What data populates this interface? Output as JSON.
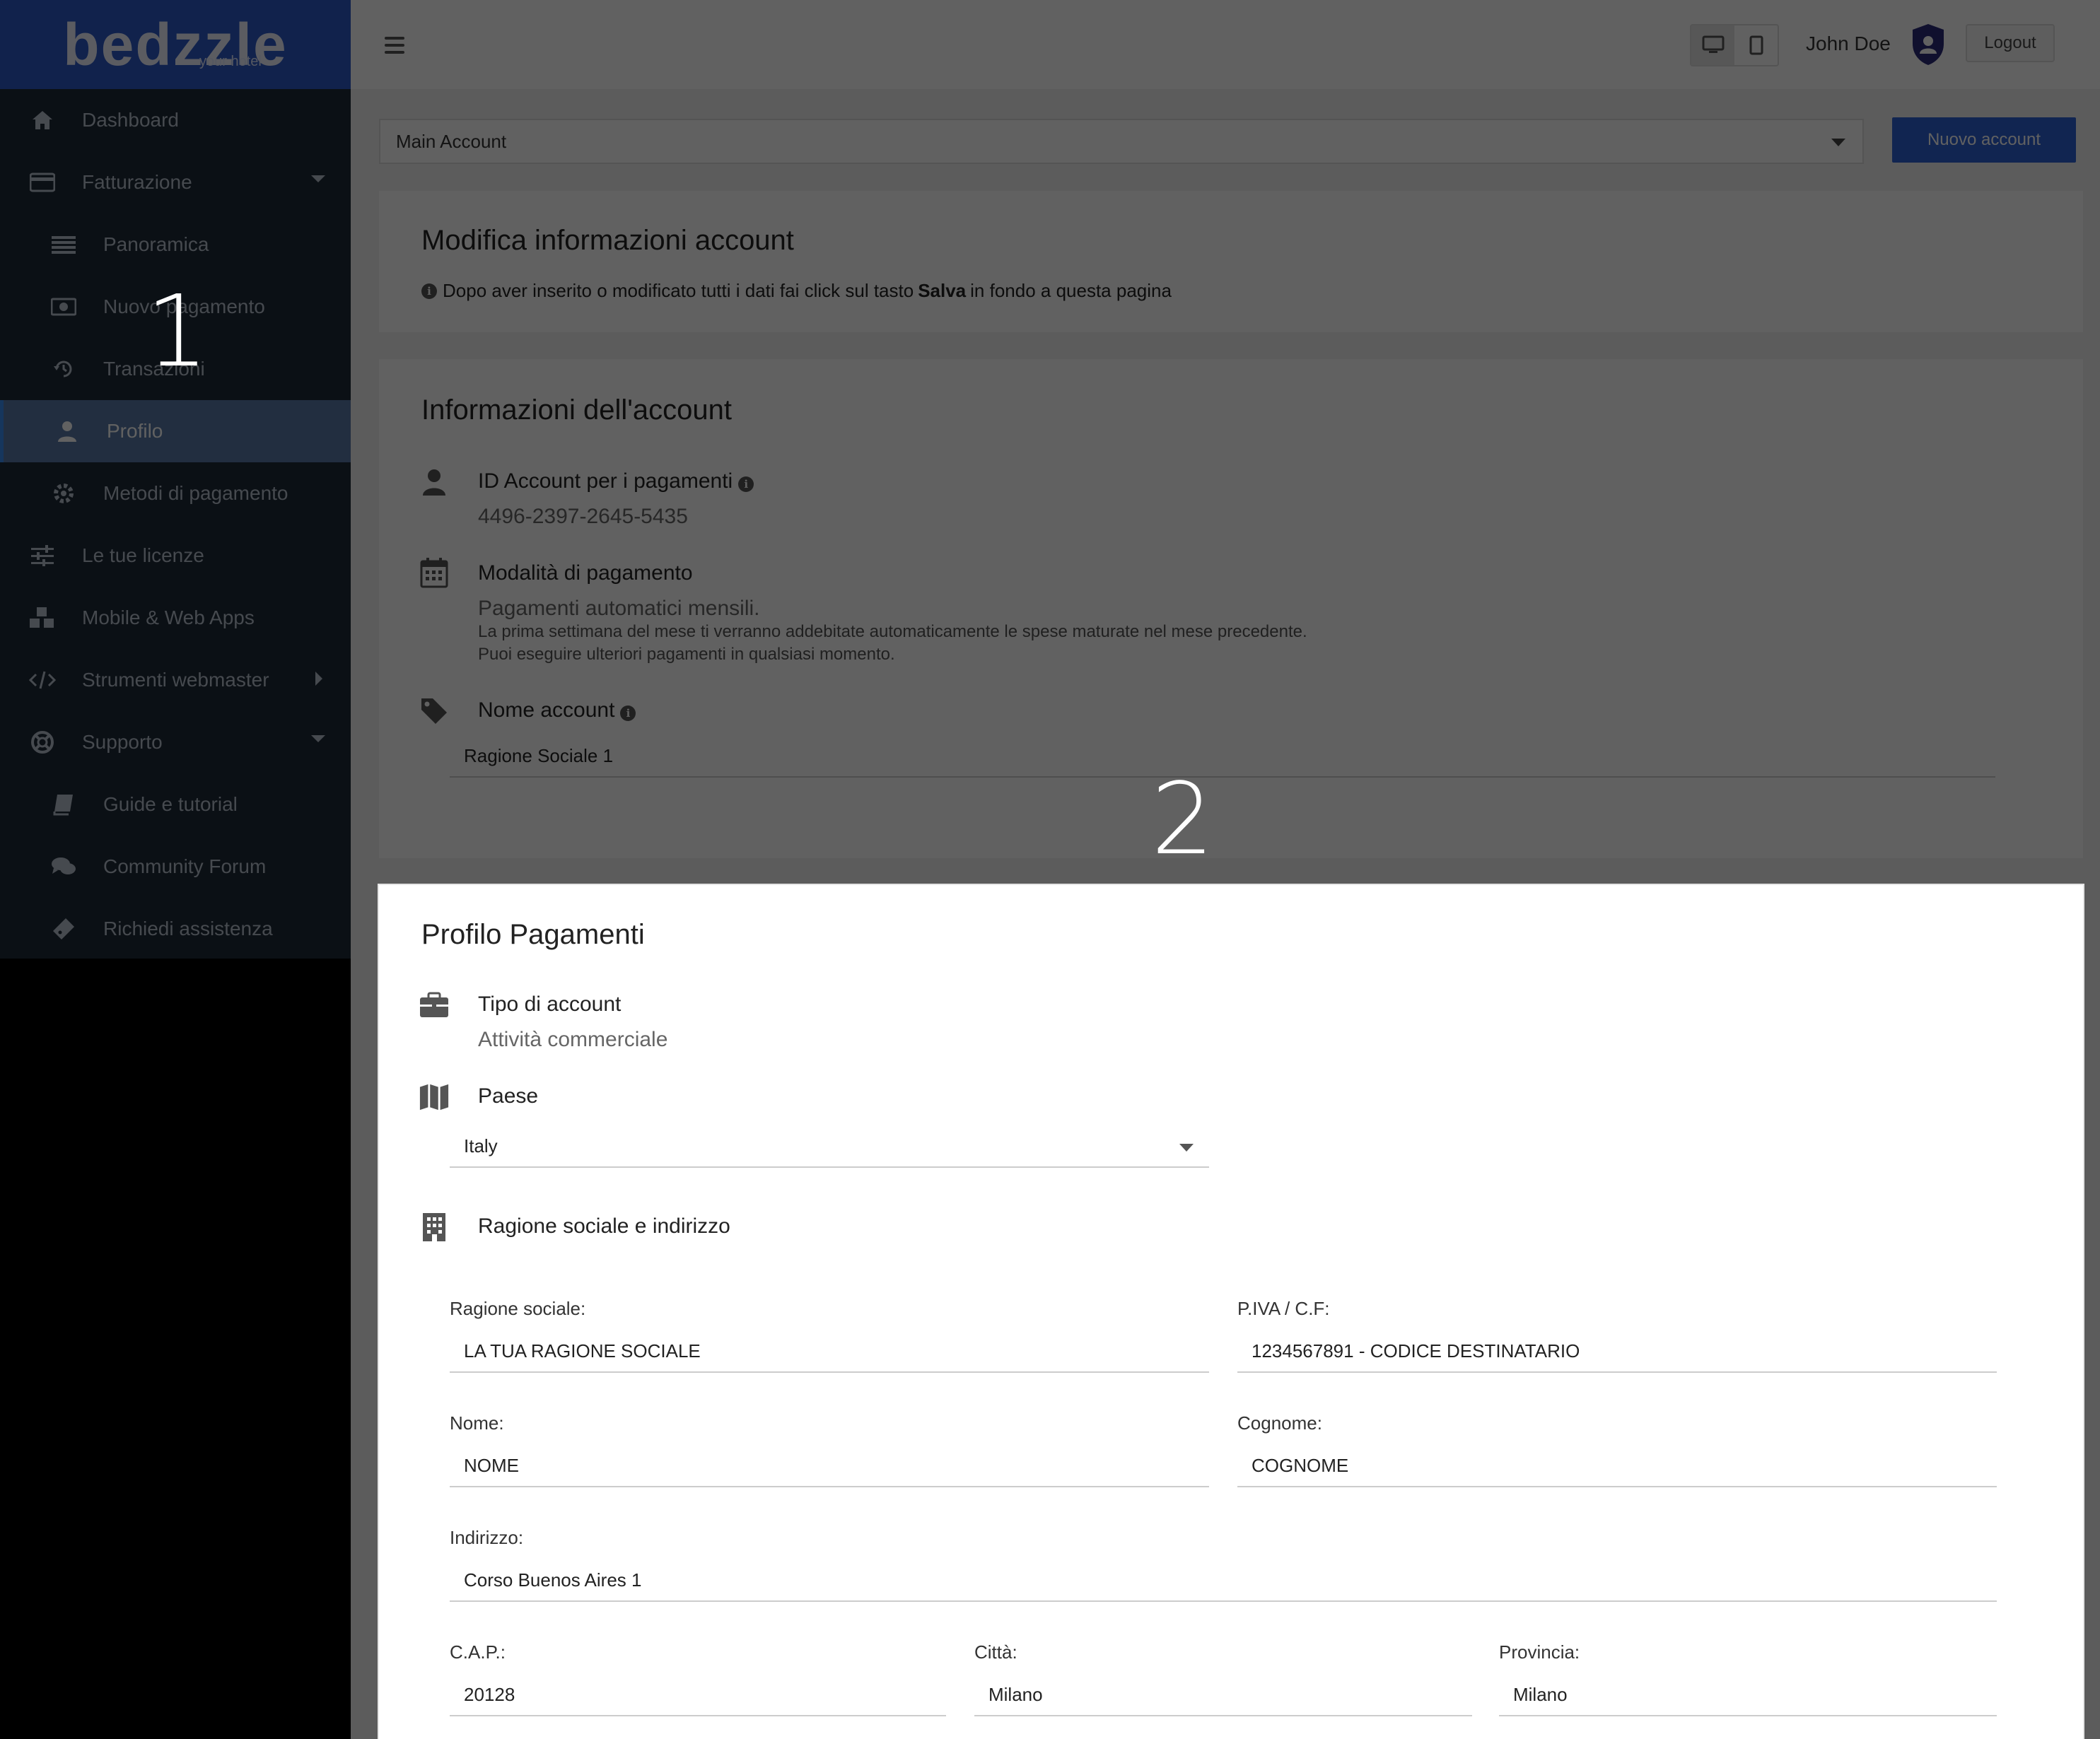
{
  "brand": {
    "logo": "bedzzle",
    "tagline": "your hotel",
    "color": "#2d59c9"
  },
  "sidebar": {
    "items": [
      {
        "label": "Dashboard",
        "icon": "home-icon",
        "level": "top"
      },
      {
        "label": "Fatturazione",
        "icon": "credit-card-icon",
        "level": "top",
        "expanded": true
      },
      {
        "label": "Panoramica",
        "icon": "list-icon",
        "level": "sub"
      },
      {
        "label": "Nuovo pagamento",
        "icon": "money-icon",
        "level": "sub"
      },
      {
        "label": "Transazioni",
        "icon": "history-icon",
        "level": "sub"
      },
      {
        "label": "Profilo",
        "icon": "user-icon",
        "level": "sub",
        "active": true
      },
      {
        "label": "Metodi di pagamento",
        "icon": "gear-icon",
        "level": "sub"
      },
      {
        "label": "Le tue licenze",
        "icon": "sliders-icon",
        "level": "top"
      },
      {
        "label": "Mobile & Web Apps",
        "icon": "cubes-icon",
        "level": "top"
      },
      {
        "label": "Strumenti webmaster",
        "icon": "code-icon",
        "level": "top",
        "expanded": false
      },
      {
        "label": "Supporto",
        "icon": "lifebuoy-icon",
        "level": "top",
        "expanded": true
      },
      {
        "label": "Guide e tutorial",
        "icon": "book-icon",
        "level": "sub"
      },
      {
        "label": "Community Forum",
        "icon": "comments-icon",
        "level": "sub"
      },
      {
        "label": "Richiedi assistenza",
        "icon": "ticket-icon",
        "level": "sub"
      }
    ]
  },
  "header": {
    "user_name": "John Doe",
    "logout_label": "Logout",
    "device_toggle": [
      "desktop-icon",
      "tablet-icon"
    ]
  },
  "account_select": {
    "value": "Main Account"
  },
  "new_account_label": "Nuovo account",
  "edit_card": {
    "title": "Modifica informazioni account",
    "info_before": "Dopo aver inserito o modificato tutti i dati fai click sul tasto",
    "info_bold": "Salva",
    "info_after": "in fondo a questa pagina"
  },
  "account_info": {
    "title": "Informazioni dell'account",
    "id_label": "ID Account per i pagamenti",
    "id_value": "4496-2397-2645-5435",
    "payment_mode_label": "Modalità di pagamento",
    "payment_mode_value": "Pagamenti automatici mensili.",
    "payment_mode_note1": "La prima settimana del mese ti verranno addebitate automaticamente le spese maturate nel mese precedente.",
    "payment_mode_note2": "Puoi eseguire ulteriori pagamenti in qualsiasi momento.",
    "account_name_label": "Nome account",
    "account_name_value": "Ragione Sociale 1"
  },
  "payment_profile": {
    "title": "Profilo Pagamenti",
    "type_label": "Tipo di account",
    "type_value": "Attività commerciale",
    "country_label": "Paese",
    "country_value": "Italy",
    "company_section_label": "Ragione sociale e indirizzo",
    "fields": {
      "ragione_sociale": {
        "label": "Ragione sociale:",
        "value": "LA TUA RAGIONE SOCIALE"
      },
      "piva": {
        "label": "P.IVA / C.F:",
        "value": "1234567891 - CODICE DESTINATARIO"
      },
      "nome": {
        "label": "Nome:",
        "value": "NOME"
      },
      "cognome": {
        "label": "Cognome:",
        "value": "COGNOME"
      },
      "indirizzo": {
        "label": "Indirizzo:",
        "value": "Corso Buenos Aires 1"
      },
      "cap": {
        "label": "C.A.P.:",
        "value": "20128"
      },
      "citta": {
        "label": "Città:",
        "value": "Milano"
      },
      "provincia": {
        "label": "Provincia:",
        "value": "Milano"
      }
    }
  },
  "annotations": {
    "step1": "1",
    "step2": "2"
  }
}
